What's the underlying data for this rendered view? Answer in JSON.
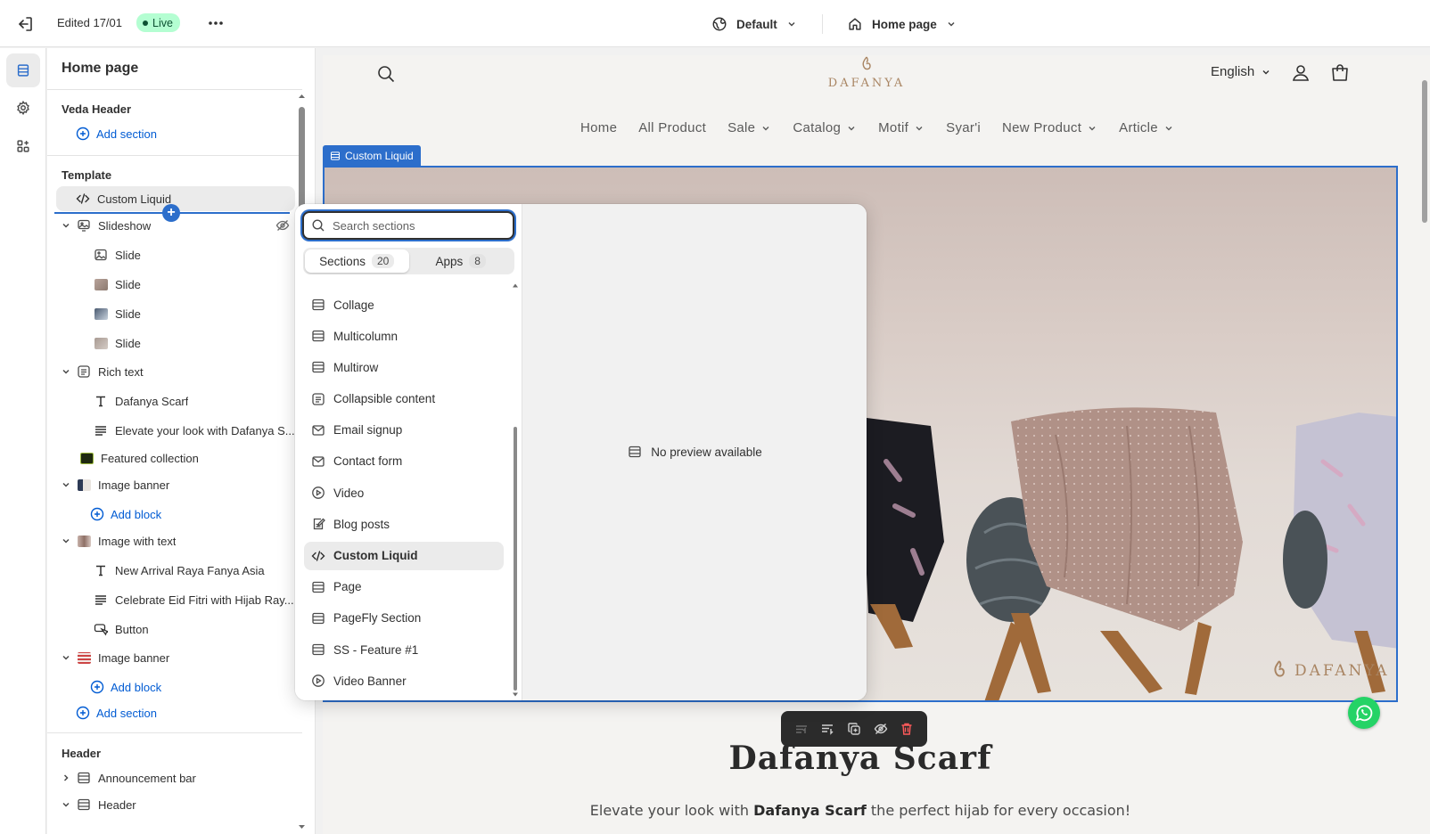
{
  "topbar": {
    "edited": "Edited 17/01",
    "live": "Live",
    "theme": "Default",
    "page": "Home page"
  },
  "rail": {
    "items": [
      "sections-icon",
      "settings-icon",
      "apps-icon"
    ]
  },
  "sidebar": {
    "title": "Home page",
    "header_group": "Veda Header",
    "add_section": "Add section",
    "template_group": "Template",
    "items": [
      {
        "label": "Custom Liquid",
        "icon": "code-icon"
      },
      {
        "label": "Slideshow",
        "icon": "slideshow-icon"
      },
      {
        "label": "Slide",
        "icon": "slide-icon"
      },
      {
        "label": "Slide",
        "icon": "slide-thumb"
      },
      {
        "label": "Slide",
        "icon": "slide-thumb"
      },
      {
        "label": "Slide",
        "icon": "slide-thumb"
      },
      {
        "label": "Rich text",
        "icon": "rich-text-icon"
      },
      {
        "label": "Dafanya Scarf",
        "icon": "text-icon"
      },
      {
        "label": "Elevate your look with Dafanya S...",
        "icon": "paragraph-icon"
      },
      {
        "label": "Featured collection",
        "icon": "collection-thumb"
      },
      {
        "label": "Image banner",
        "icon": "image-thumb"
      },
      {
        "label": "Image with text",
        "icon": "image-thumb"
      },
      {
        "label": "New Arrival Raya Fanya Asia",
        "icon": "text-icon"
      },
      {
        "label": "Celebrate Eid Fitri with Hijab Ray...",
        "icon": "paragraph-icon"
      },
      {
        "label": "Button",
        "icon": "button-icon"
      },
      {
        "label": "Image banner",
        "icon": "image-thumb"
      }
    ],
    "add_block": "Add block",
    "header_section_group": "Header",
    "header_items": [
      {
        "label": "Announcement bar"
      },
      {
        "label": "Header"
      }
    ]
  },
  "popover": {
    "search_placeholder": "Search sections",
    "tabs": [
      {
        "label": "Sections",
        "count": "20"
      },
      {
        "label": "Apps",
        "count": "8"
      }
    ],
    "items": [
      {
        "label": "Collage",
        "icon": "section-icon"
      },
      {
        "label": "Multicolumn",
        "icon": "section-icon"
      },
      {
        "label": "Multirow",
        "icon": "section-icon"
      },
      {
        "label": "Collapsible content",
        "icon": "list-icon"
      },
      {
        "label": "Email signup",
        "icon": "email-icon"
      },
      {
        "label": "Contact form",
        "icon": "email-icon"
      },
      {
        "label": "Video",
        "icon": "play-icon"
      },
      {
        "label": "Blog posts",
        "icon": "blog-icon"
      },
      {
        "label": "Custom Liquid",
        "icon": "code-icon"
      },
      {
        "label": "Page",
        "icon": "section-icon"
      },
      {
        "label": "PageFly Section",
        "icon": "section-icon"
      },
      {
        "label": "SS - Feature #1",
        "icon": "section-icon"
      },
      {
        "label": "Video Banner",
        "icon": "play-icon"
      }
    ],
    "no_preview": "No preview available"
  },
  "preview": {
    "logo": "DAFANYA",
    "language": "English",
    "nav": [
      {
        "label": "Home",
        "dropdown": false
      },
      {
        "label": "All Product",
        "dropdown": false
      },
      {
        "label": "Sale",
        "dropdown": true
      },
      {
        "label": "Catalog",
        "dropdown": true
      },
      {
        "label": "Motif",
        "dropdown": true
      },
      {
        "label": "Syar'i",
        "dropdown": false
      },
      {
        "label": "New Product",
        "dropdown": true
      },
      {
        "label": "Article",
        "dropdown": true
      }
    ],
    "section_label": "Custom Liquid",
    "banner_logo": "DAFANYA",
    "heading": "Dafanya Scarf",
    "subtext_pre": "Elevate your look with ",
    "subtext_bold": "Dafanya Scarf",
    "subtext_post": " the perfect hijab for every occasion!"
  },
  "colors": {
    "accent": "#2c6ecb",
    "live_bg": "#b4fed2",
    "brand_gold": "#a98563"
  }
}
